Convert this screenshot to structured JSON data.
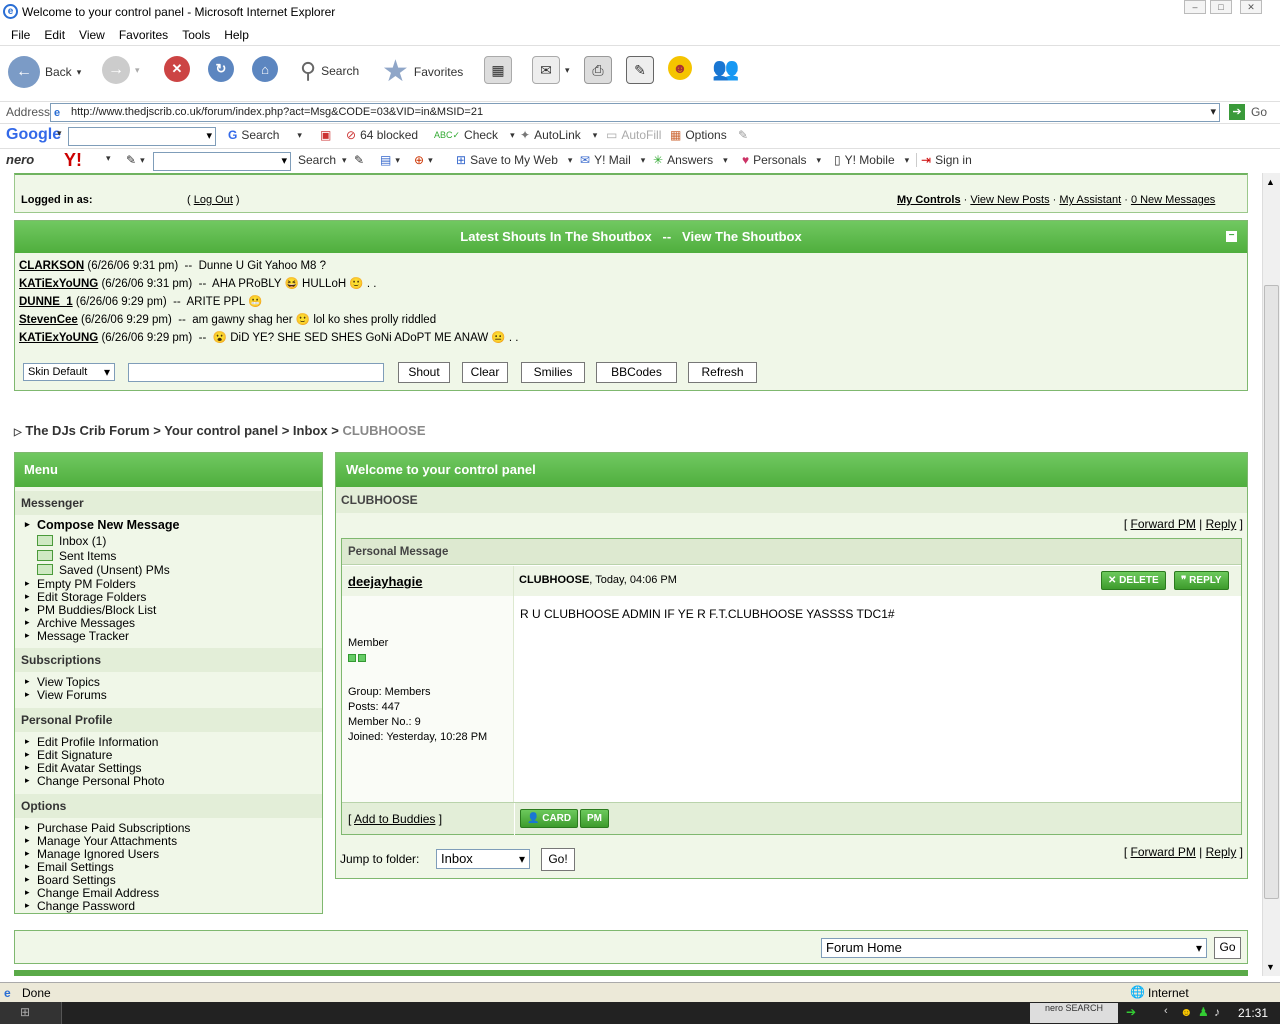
{
  "window": {
    "title": "Welcome to your control panel - Microsoft Internet Explorer"
  },
  "menubar": [
    "File",
    "Edit",
    "View",
    "Favorites",
    "Tools",
    "Help"
  ],
  "toolbar": {
    "back": "Back",
    "search": "Search",
    "favorites": "Favorites"
  },
  "address": {
    "label": "Address",
    "url": "http://www.thedjscrib.co.uk/forum/index.php?act=Msg&CODE=03&VID=in&MSID=21",
    "go": "Go"
  },
  "google_bar": {
    "logo": "Google",
    "search": "Search",
    "blocked": "64 blocked",
    "check": "Check",
    "autolink": "AutoLink",
    "autofill": "AutoFill",
    "options": "Options"
  },
  "yahoo_bar": {
    "nero": "nero",
    "yahoo": "Y!",
    "search": "Search",
    "save": "Save to My Web",
    "mail": "Y! Mail",
    "answers": "Answers",
    "personals": "Personals",
    "mobile": "Y! Mobile",
    "signin": "Sign in"
  },
  "userbar": {
    "logged_in": "Logged in as:",
    "logout": "Log Out",
    "my_controls": "My Controls",
    "view_new": "View New Posts",
    "assistant": "My Assistant",
    "new_messages": "0 New Messages"
  },
  "shoutbox": {
    "title": "Latest Shouts In The Shoutbox",
    "sep": "--",
    "view": "View The Shoutbox",
    "collapse": "−",
    "shouts": [
      {
        "user": "CLARKSON",
        "time": "(6/26/06 9:31 pm)",
        "sep": "--",
        "text": "Dunne U Git Yahoo M8 ?",
        "pre": "",
        "post": ""
      },
      {
        "user": "KATiExYoUNG",
        "time": "(6/26/06 9:31 pm)",
        "sep": "--",
        "text": "AHA PRoBLY",
        "pre": "",
        "post": "HULLoH 🙂 . ."
      },
      {
        "user": "DUNNE_1",
        "time": "(6/26/06 9:29 pm)",
        "sep": "--",
        "text": "ARITE PPL",
        "pre": "",
        "post": ""
      },
      {
        "user": "StevenCee",
        "time": "(6/26/06 9:29 pm)",
        "sep": "--",
        "text": "am gawny shag her",
        "pre": "",
        "post": "lol ko shes prolly riddled"
      },
      {
        "user": "KATiExYoUNG",
        "time": "(6/26/06 9:29 pm)",
        "sep": "--",
        "text": "",
        "pre": "😮",
        "post": "DiD YE? SHE SED SHES GoNi ADoPT ME ANAW 😐 . ."
      }
    ],
    "skin": "Skin Default",
    "buttons": {
      "shout": "Shout",
      "clear": "Clear",
      "smilies": "Smilies",
      "bbcodes": "BBCodes",
      "refresh": "Refresh"
    }
  },
  "breadcrumb": {
    "marker": "▷",
    "items": [
      "The DJs Crib Forum",
      "Your control panel",
      "Inbox"
    ],
    "current": "CLUBHOOSE",
    "sep": ">"
  },
  "menu": {
    "title": "Menu",
    "messenger": "Messenger",
    "compose": "Compose New Message",
    "folders": [
      "Inbox (1)",
      "Sent Items",
      "Saved (Unsent) PMs"
    ],
    "messenger_items": [
      "Empty PM Folders",
      "Edit Storage Folders",
      "PM Buddies/Block List",
      "Archive Messages",
      "Message Tracker"
    ],
    "subscriptions": "Subscriptions",
    "sub_items": [
      "View Topics",
      "View Forums"
    ],
    "profile": "Personal Profile",
    "profile_items": [
      "Edit Profile Information",
      "Edit Signature",
      "Edit Avatar Settings",
      "Change Personal Photo"
    ],
    "options": "Options",
    "options_items": [
      "Purchase Paid Subscriptions",
      "Manage Your Attachments",
      "Manage Ignored Users",
      "Email Settings",
      "Board Settings",
      "Change Email Address",
      "Change Password"
    ]
  },
  "main": {
    "title": "Welcome to your control panel",
    "folder": "CLUBHOOSE",
    "forward": "Forward PM",
    "reply": "Reply",
    "pm_header": "Personal Message",
    "author": "deejayhagie",
    "subject": "CLUBHOOSE",
    "date": ", Today, 04:06 PM",
    "delete": "DELETE",
    "reply_btn": "REPLY",
    "body": "R U CLUBHOOSE ADMIN IF YE R F.T.CLUBHOOSE YASSSS TDC1#",
    "rank": "Member",
    "group": "Group: Members",
    "posts": "Posts: 447",
    "member_no": "Member No.: 9",
    "joined": "Joined: Yesterday, 10:28 PM",
    "add_buddies": "Add to Buddies",
    "card": "CARD",
    "pm": "PM",
    "jump_label": "Jump to folder:",
    "jump_value": "Inbox",
    "go": "Go!"
  },
  "footer": {
    "forum_home": "Forum Home",
    "go": "Go"
  },
  "status": {
    "text": "Done",
    "zone": "Internet"
  },
  "taskbar": {
    "time": "21:31",
    "nero": "nero SEARCH"
  },
  "colors": {
    "green": "#5bb84a",
    "panel": "#f0f7e8",
    "menuhead": "#e3eed8"
  }
}
